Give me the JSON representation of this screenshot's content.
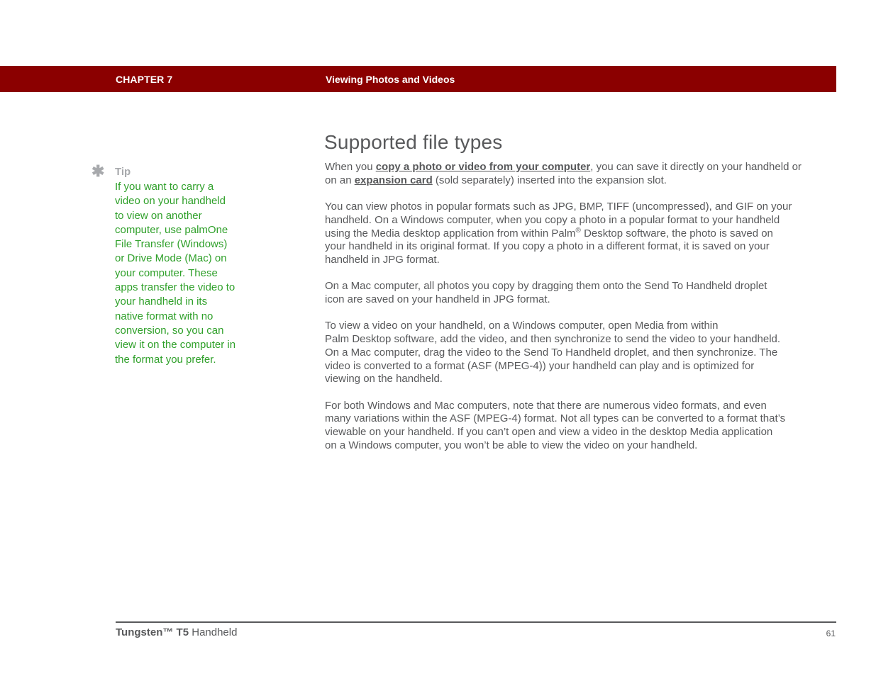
{
  "header": {
    "chapter": "CHAPTER 7",
    "title": "Viewing Photos and Videos",
    "bar_color": "#8b0000"
  },
  "tip": {
    "icon": "asterisk-icon",
    "label": "Tip",
    "lines": [
      "If you want to carry a",
      "video on your handheld",
      "to view on another",
      "computer, use palmOne",
      "File Transfer (Windows)",
      "or Drive Mode (Mac) on",
      "your computer. These",
      "apps transfer the video to",
      "your handheld in its",
      "native format with no",
      "conversion, so you can",
      "view it on the computer in",
      "the format you prefer."
    ],
    "color": "#2fa02a"
  },
  "section": {
    "heading": "Supported file types",
    "para1": {
      "line1_pre": "When you ",
      "link1": "copy a photo or video from your computer",
      "line1_post": ", you can save it directly on your handheld or",
      "line2_pre": "on an ",
      "link2": "expansion card",
      "line2_post": " (sold separately) inserted into the expansion slot."
    },
    "para2": {
      "line1": "You can view photos in popular formats such as JPG, BMP, TIFF (uncompressed), and GIF on your",
      "line2": "handheld. On a Windows computer, when you copy a photo in a popular format to your handheld",
      "line3_pre": "using the Media desktop application from within Palm",
      "line3_sup": "®",
      "line3_post": " Desktop software, the photo is saved on",
      "line4": "your handheld in its original format. If you copy a photo in a different format, it is saved on your",
      "line5": "handheld in JPG format."
    },
    "para3": {
      "lines": [
        "On a Mac computer, all photos you copy by dragging them onto the Send To Handheld droplet",
        "icon are saved on your handheld in JPG format."
      ]
    },
    "para4": {
      "lines": [
        "To view a video on your handheld, on a Windows computer, open Media from within",
        "Palm Desktop software, add the video, and then synchronize to send the video to your handheld.",
        "On a Mac computer, drag the video to the Send To Handheld droplet, and then synchronize. The",
        "video is converted to a format (ASF (MPEG-4)) your handheld can play and is optimized for",
        "viewing on the handheld."
      ]
    },
    "para5": {
      "lines": [
        "For both Windows and Mac computers, note that there are numerous video formats, and even",
        "many variations within the ASF (MPEG-4) format. Not all types can be converted to a format that’s",
        "viewable on your handheld. If you can’t open and view a video in the desktop Media application",
        "on a Windows computer, you won’t be able to view the video on your handheld."
      ]
    }
  },
  "footer": {
    "product_bold": "Tungsten™ T5",
    "product_rest": " Handheld",
    "page_number": "61"
  }
}
